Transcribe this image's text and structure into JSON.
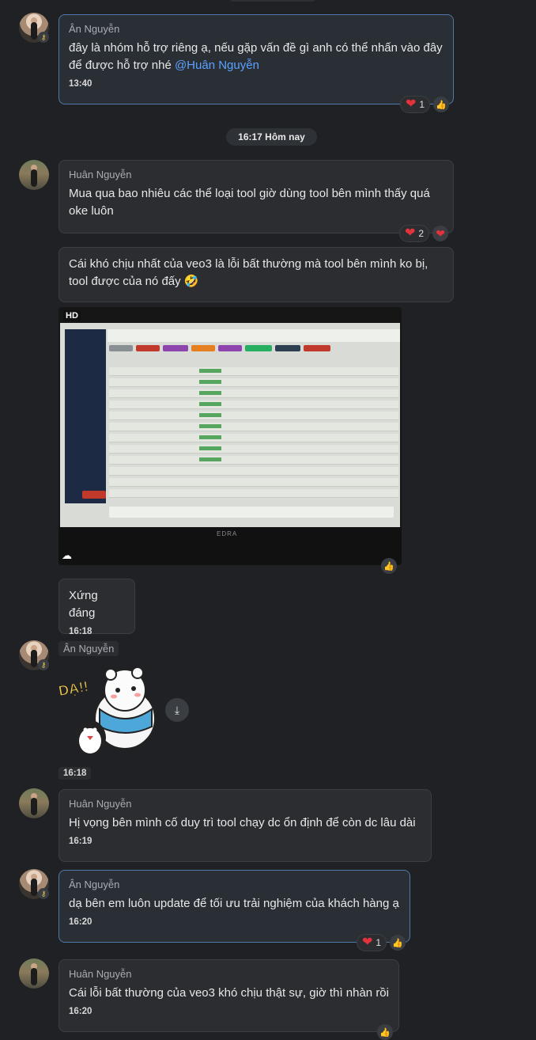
{
  "messages": [
    {
      "sender": "Ân Nguyễn",
      "text": "đây là nhóm hỗ trợ riêng ạ, nếu gặp vấn đề gì anh có thể nhấn vào đây để được hỗ trợ nhé ",
      "mention": "@Huân Nguyễn",
      "time": "13:40",
      "reaction_count": "1"
    },
    {
      "sender": "Huân Nguyễn",
      "text": "Mua qua bao nhiêu các thể loại tool giờ dùng tool bên mình thấy quá oke luôn",
      "reaction_count": "2"
    },
    {
      "text": "Cái khó chịu nhất của veo3 là lỗi bất thường mà tool bên mình ko bị, tool được của nó đấy",
      "emoji": "🤣"
    },
    {
      "image_badge": "HD",
      "image_brand": "EDRA"
    },
    {
      "text": "Xứng đáng",
      "time": "16:18"
    },
    {
      "sender": "Ân Nguyễn",
      "sticker_text": "DẠ!!",
      "time": "16:18"
    },
    {
      "sender": "Huân Nguyễn",
      "text": "Hị vọng bên mình cố duy trì tool chạy dc ổn định để còn dc lâu dài",
      "time": "16:19"
    },
    {
      "sender": "Ân Nguyễn",
      "text": "dạ bên em luôn update để tối ưu trải nghiệm của khách hàng ạ",
      "time": "16:20",
      "reaction_count": "1"
    },
    {
      "sender": "Huân Nguyễn",
      "text": "Cái lỗi bất thường của veo3 khó chịu thật sự, giờ thì nhàn rồi",
      "time": "16:20"
    }
  ],
  "day_separator": "16:17 Hôm nay",
  "icons": {
    "heart": "heart-icon",
    "like": "thumbs-up-icon",
    "download": "download-icon",
    "cloud": "cloud-icon",
    "key": "key-icon"
  }
}
